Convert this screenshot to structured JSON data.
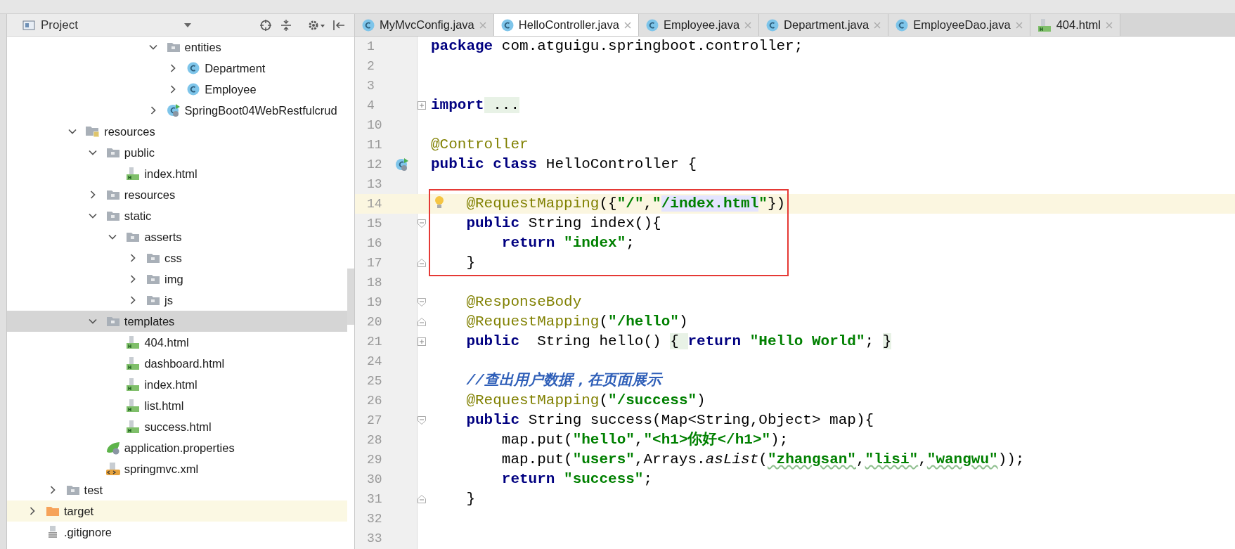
{
  "project_panel": {
    "title": "Project",
    "tree": [
      {
        "children": [
          {
            "children": [
              {
                "children": [
                  {
                    "children": [
                      {
                        "children": [
                          {
                            "children": [
                              {
                                "label": "entities",
                                "kind": "folder",
                                "expanded": true,
                                "selected": false,
                                "children": [
                                  {
                                    "label": "Department",
                                    "kind": "class",
                                    "expanded": false,
                                    "selected": false
                                  },
                                  {
                                    "label": "Employee",
                                    "kind": "class",
                                    "expanded": false,
                                    "selected": false
                                  }
                                ]
                              },
                              {
                                "label": "SpringBoot04WebRestfulcrud",
                                "kind": "spring-class",
                                "expanded": false,
                                "selected": false
                              }
                            ]
                          }
                        ]
                      }
                    ]
                  }
                ]
              },
              {
                "label": "resources",
                "kind": "resource-folder",
                "expanded": true,
                "selected": false,
                "children": [
                  {
                    "label": "public",
                    "kind": "folder",
                    "expanded": true,
                    "selected": false,
                    "children": [
                      {
                        "label": "index.html",
                        "kind": "html",
                        "selected": false
                      }
                    ]
                  },
                  {
                    "label": "resources",
                    "kind": "folder",
                    "expanded": false,
                    "selected": false
                  },
                  {
                    "label": "static",
                    "kind": "folder",
                    "expanded": true,
                    "selected": false,
                    "children": [
                      {
                        "label": "asserts",
                        "kind": "folder",
                        "expanded": true,
                        "selected": false,
                        "children": [
                          {
                            "label": "css",
                            "kind": "folder",
                            "expanded": false,
                            "selected": false
                          },
                          {
                            "label": "img",
                            "kind": "folder",
                            "expanded": false,
                            "selected": false
                          },
                          {
                            "label": "js",
                            "kind": "folder",
                            "expanded": false,
                            "selected": false
                          }
                        ]
                      }
                    ]
                  },
                  {
                    "label": "templates",
                    "kind": "folder",
                    "expanded": true,
                    "selected": true,
                    "children": [
                      {
                        "label": "404.html",
                        "kind": "html",
                        "selected": false
                      },
                      {
                        "label": "dashboard.html",
                        "kind": "html",
                        "selected": false
                      },
                      {
                        "label": "index.html",
                        "kind": "html",
                        "selected": false
                      },
                      {
                        "label": "list.html",
                        "kind": "html",
                        "selected": false
                      },
                      {
                        "label": "success.html",
                        "kind": "html",
                        "selected": false
                      }
                    ]
                  },
                  {
                    "label": "application.properties",
                    "kind": "properties",
                    "selected": false
                  },
                  {
                    "label": "springmvc.xml",
                    "kind": "xml",
                    "selected": false
                  }
                ]
              }
            ]
          },
          {
            "label": "test",
            "kind": "folder",
            "expanded": false,
            "selected": false
          }
        ]
      },
      {
        "label": "target",
        "kind": "excluded-folder",
        "expanded": false,
        "selected": false
      },
      {
        "label": ".gitignore",
        "kind": "text-file",
        "selected": false
      }
    ]
  },
  "tabs": [
    {
      "label": "MyMvcConfig.java",
      "kind": "class",
      "selected": false
    },
    {
      "label": "HelloController.java",
      "kind": "class",
      "selected": true
    },
    {
      "label": "Employee.java",
      "kind": "class",
      "selected": false
    },
    {
      "label": "Department.java",
      "kind": "class",
      "selected": false
    },
    {
      "label": "EmployeeDao.java",
      "kind": "class",
      "selected": false
    },
    {
      "label": "404.html",
      "kind": "html",
      "selected": false
    }
  ],
  "editor": {
    "lines": [
      {
        "kind": "line",
        "n": "1",
        "current": false,
        "tokens": [
          {
            "kind": "kw",
            "text": "package"
          },
          {
            "kind": "plain",
            "text": " com.atguigu.springboot.controller;"
          }
        ]
      },
      {
        "kind": "line",
        "n": "2",
        "current": false
      },
      {
        "kind": "line",
        "n": "3",
        "current": false
      },
      {
        "kind": "folded",
        "n": "4",
        "current": false,
        "tokens": [
          {
            "kind": "kw",
            "text": "import"
          },
          {
            "kind": "folded",
            "text": " ..."
          }
        ]
      },
      {
        "kind": "line",
        "n": "10",
        "current": false
      },
      {
        "kind": "line",
        "n": "11",
        "current": false,
        "tokens": [
          {
            "kind": "ann",
            "text": "@Controller"
          }
        ]
      },
      {
        "kind": "class-header",
        "n": "12",
        "current": false,
        "tokens": [
          {
            "kind": "kw",
            "text": "public class"
          },
          {
            "kind": "plain",
            "text": " HelloController {"
          }
        ]
      },
      {
        "kind": "line",
        "n": "13",
        "current": false
      },
      {
        "kind": "framed-group",
        "lines": [
          {
            "kind": "line",
            "n": "14",
            "current": true,
            "tokens": [
              {
                "kind": "ann",
                "text": "    @RequestMapping"
              },
              {
                "kind": "plain",
                "text": "({"
              },
              {
                "kind": "str",
                "text": "\"/\""
              },
              {
                "kind": "plain",
                "text": ","
              },
              {
                "kind": "str",
                "text": "\""
              },
              {
                "kind": "str-mark",
                "text": "/index.html"
              },
              {
                "kind": "str",
                "text": "\""
              },
              {
                "kind": "plain",
                "text": "})"
              }
            ]
          },
          {
            "kind": "fold-start",
            "n": "15",
            "current": false,
            "tokens": [
              {
                "kind": "kw",
                "text": "    public"
              },
              {
                "kind": "plain",
                "text": " String index(){"
              }
            ]
          },
          {
            "kind": "line",
            "n": "16",
            "current": false,
            "tokens": [
              {
                "kind": "kw",
                "text": "        return"
              },
              {
                "kind": "str",
                "text": " \"index\""
              },
              {
                "kind": "plain",
                "text": ";"
              }
            ]
          },
          {
            "kind": "fold-end",
            "n": "17",
            "current": false,
            "tokens": [
              {
                "kind": "plain",
                "text": "    }"
              }
            ]
          }
        ]
      },
      {
        "kind": "line",
        "n": "18",
        "current": false
      },
      {
        "kind": "fold-start",
        "n": "19",
        "current": false,
        "tokens": [
          {
            "kind": "ann",
            "text": "    @ResponseBody"
          }
        ]
      },
      {
        "kind": "fold-end",
        "n": "20",
        "current": false,
        "tokens": [
          {
            "kind": "ann",
            "text": "    @RequestMapping"
          },
          {
            "kind": "plain",
            "text": "("
          },
          {
            "kind": "str",
            "text": "\"/hello\""
          },
          {
            "kind": "plain",
            "text": ")"
          }
        ]
      },
      {
        "kind": "folded",
        "n": "21",
        "current": false,
        "tokens": [
          {
            "kind": "kw",
            "text": "    public"
          },
          {
            "kind": "plain",
            "text": "  String hello() "
          },
          {
            "kind": "folded",
            "text": "{ "
          },
          {
            "kind": "kw",
            "text": "return"
          },
          {
            "kind": "str",
            "text": " \"Hello World\""
          },
          {
            "kind": "plain",
            "text": "; "
          },
          {
            "kind": "folded",
            "text": "}"
          }
        ]
      },
      {
        "kind": "line",
        "n": "24",
        "current": false
      },
      {
        "kind": "line",
        "n": "25",
        "current": false,
        "tokens": [
          {
            "kind": "comment",
            "text": "    //查出用户数据，在页面展示"
          }
        ]
      },
      {
        "kind": "line",
        "n": "26",
        "current": false,
        "tokens": [
          {
            "kind": "ann",
            "text": "    @RequestMapping"
          },
          {
            "kind": "plain",
            "text": "("
          },
          {
            "kind": "str",
            "text": "\"/success\""
          },
          {
            "kind": "plain",
            "text": ")"
          }
        ]
      },
      {
        "kind": "fold-start",
        "n": "27",
        "current": false,
        "tokens": [
          {
            "kind": "kw",
            "text": "    public"
          },
          {
            "kind": "plain",
            "text": " String success(Map<String,Object> map){"
          }
        ]
      },
      {
        "kind": "line",
        "n": "28",
        "current": false,
        "tokens": [
          {
            "kind": "plain",
            "text": "        map.put("
          },
          {
            "kind": "str",
            "text": "\"hello\""
          },
          {
            "kind": "plain",
            "text": ","
          },
          {
            "kind": "str",
            "text": "\"<h1>你好</h1>\""
          },
          {
            "kind": "plain",
            "text": ");"
          }
        ]
      },
      {
        "kind": "line",
        "n": "29",
        "current": false,
        "tokens": [
          {
            "kind": "plain",
            "text": "        map.put("
          },
          {
            "kind": "str",
            "text": "\"users\""
          },
          {
            "kind": "plain",
            "text": ",Arrays."
          },
          {
            "kind": "static",
            "text": "asList"
          },
          {
            "kind": "plain",
            "text": "("
          },
          {
            "kind": "str-typo",
            "text": "\"zhangsan\""
          },
          {
            "kind": "plain",
            "text": ","
          },
          {
            "kind": "str-typo",
            "text": "\"lisi\""
          },
          {
            "kind": "plain",
            "text": ","
          },
          {
            "kind": "str-typo",
            "text": "\"wangwu\""
          },
          {
            "kind": "plain",
            "text": "));"
          }
        ]
      },
      {
        "kind": "line",
        "n": "30",
        "current": false,
        "tokens": [
          {
            "kind": "kw",
            "text": "        return"
          },
          {
            "kind": "str",
            "text": " \"success\""
          },
          {
            "kind": "plain",
            "text": ";"
          }
        ]
      },
      {
        "kind": "fold-end",
        "n": "31",
        "current": false,
        "tokens": [
          {
            "kind": "plain",
            "text": "    }"
          }
        ]
      },
      {
        "kind": "line",
        "n": "32",
        "current": false
      },
      {
        "kind": "line",
        "n": "33",
        "current": false
      }
    ]
  }
}
